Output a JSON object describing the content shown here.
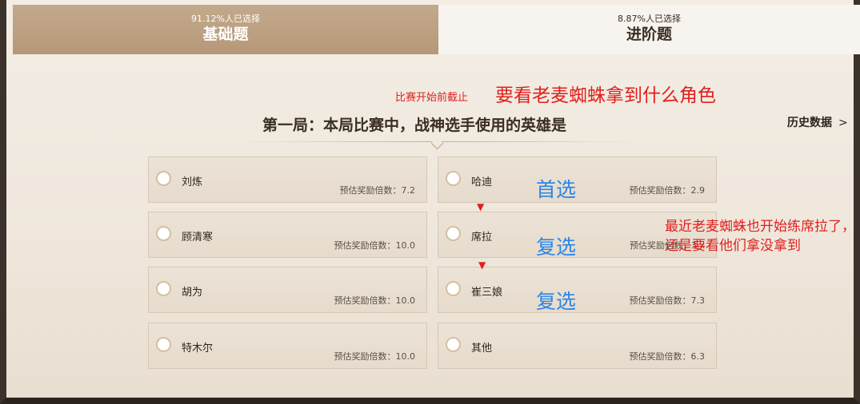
{
  "tabs": [
    {
      "pct": "91.12%人已选择",
      "label": "基础题"
    },
    {
      "pct": "8.87%人已选择",
      "label": "进阶题"
    }
  ],
  "annotations": {
    "deadline": "比赛开始前截止",
    "headline": "要看老麦蜘蛛拿到什么角色",
    "side_note": "最近老麦蜘蛛也开始练席拉了，还是要看他们拿没拿到",
    "first_pick": "首选",
    "second_pick_1": "复选",
    "second_pick_2": "复选"
  },
  "question": "第一局：本局比赛中，战神选手使用的英雄是",
  "history_link": "历史数据",
  "history_chevron": ">",
  "options": [
    {
      "name": "刘炼",
      "multiplier": "预估奖励倍数：7.2"
    },
    {
      "name": "哈迪",
      "multiplier": "预估奖励倍数：2.9"
    },
    {
      "name": "顾清寒",
      "multiplier": "预估奖励倍数：10.0"
    },
    {
      "name": "席拉",
      "multiplier": "预估奖励倍数：3.x"
    },
    {
      "name": "胡为",
      "multiplier": "预估奖励倍数：10.0"
    },
    {
      "name": "崔三娘",
      "multiplier": "预估奖励倍数：7.3"
    },
    {
      "name": "特木尔",
      "multiplier": "预估奖励倍数：10.0"
    },
    {
      "name": "其他",
      "multiplier": "预估奖励倍数：6.3"
    }
  ],
  "arrow_glyph": "▼"
}
